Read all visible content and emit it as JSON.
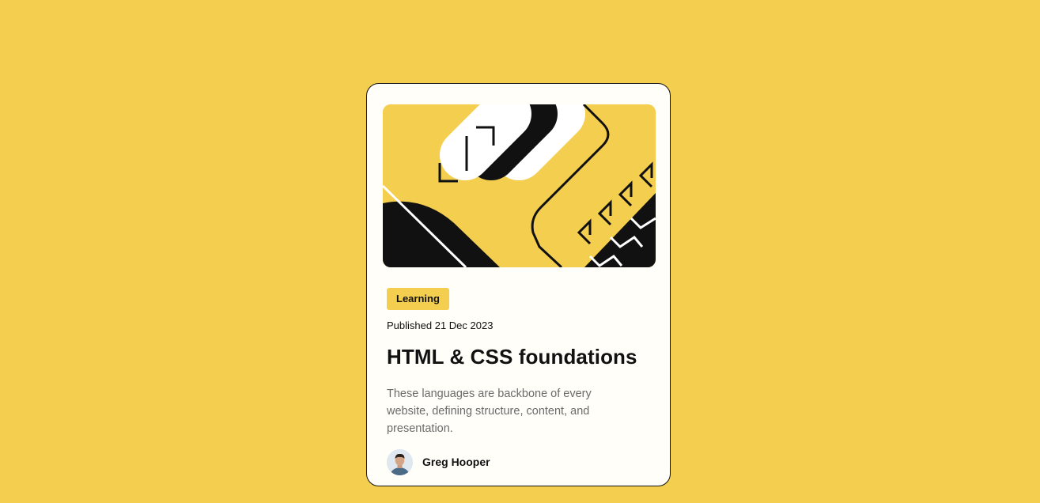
{
  "card": {
    "tag": "Learning",
    "published": "Published 21 Dec 2023",
    "title": "HTML & CSS foundations",
    "description": "These languages are backbone of every website, defining structure, content, and presentation.",
    "author": {
      "name": "Greg Hooper",
      "avatar_icon": "person-avatar"
    },
    "hero_icon": "abstract-illustration"
  },
  "colors": {
    "background": "#F4CE4E",
    "card": "#FFFEF8",
    "text": "#111111",
    "muted": "#6B6B6B"
  }
}
